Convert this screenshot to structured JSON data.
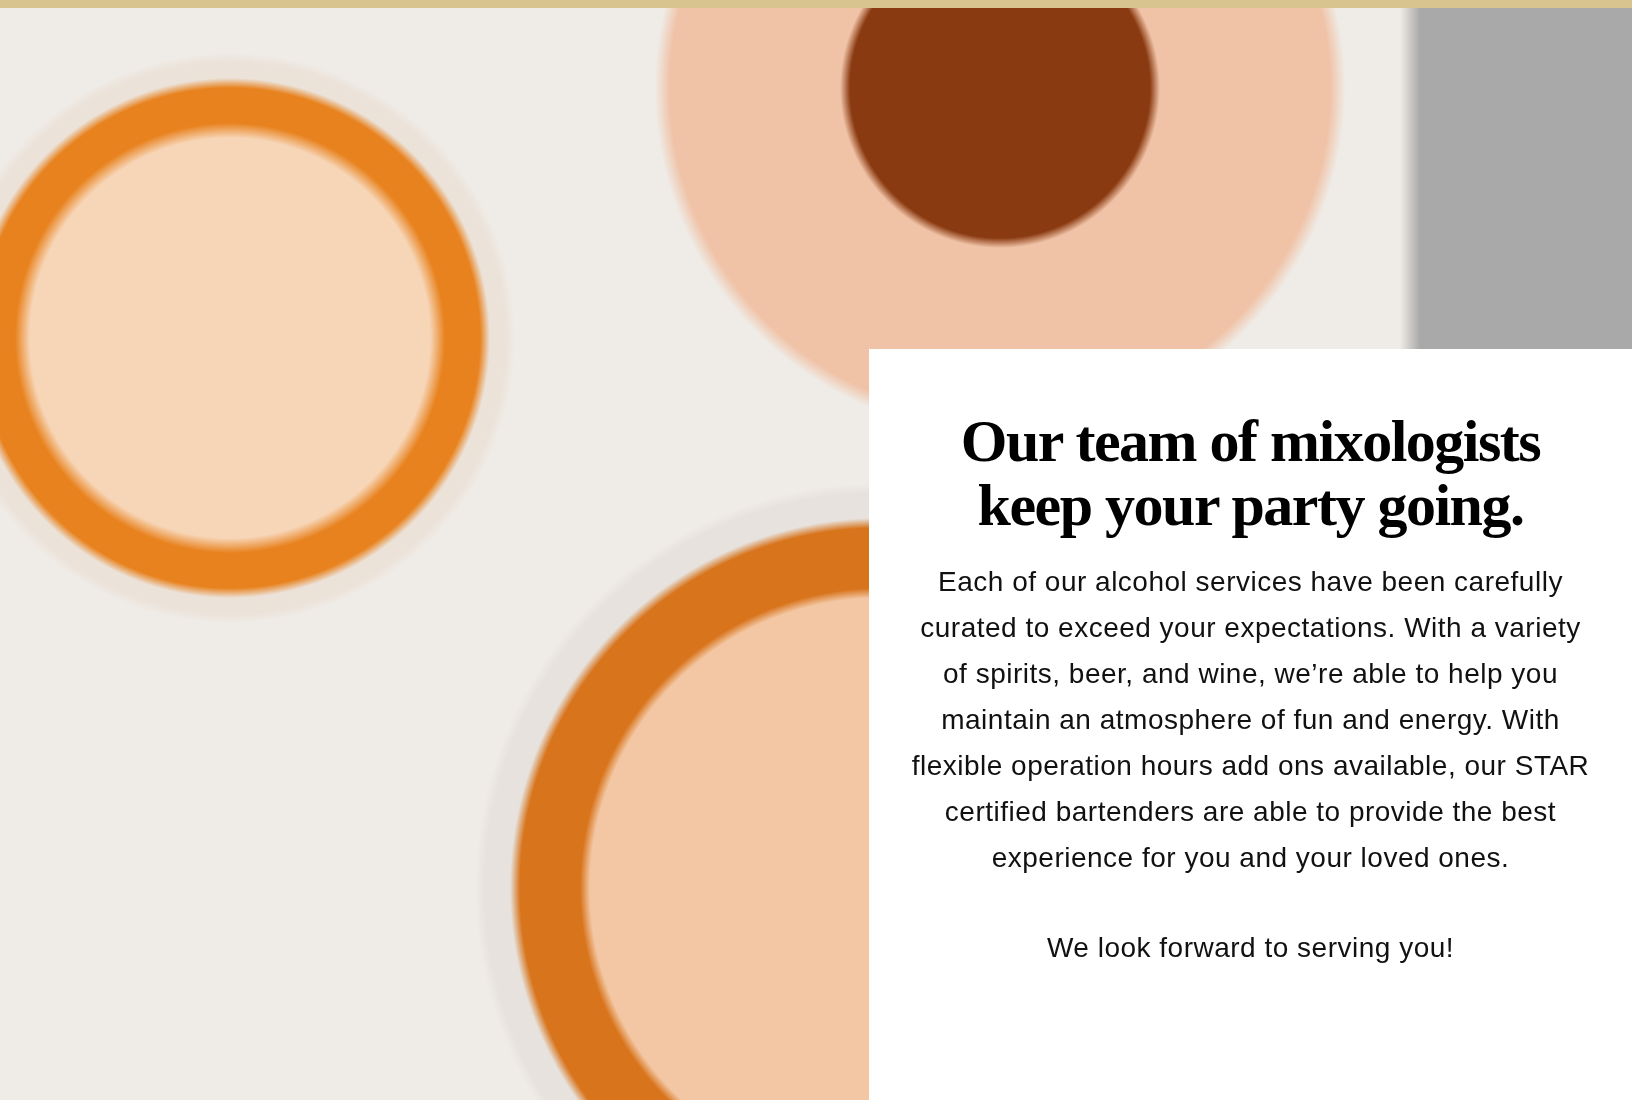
{
  "card": {
    "heading": "Our team of mixologists keep your party going.",
    "paragraphs": [
      "Each of our alcohol services have been carefully curated to exceed your expectations. With a variety of spirits, beer, and wine, we’re able to help you maintain an atmosphere of fun and energy. With flexible operation hours add ons available, our STAR certified bartenders are able to provide the best experience for you and your loved ones.",
      "We look forward to serving you!"
    ]
  }
}
